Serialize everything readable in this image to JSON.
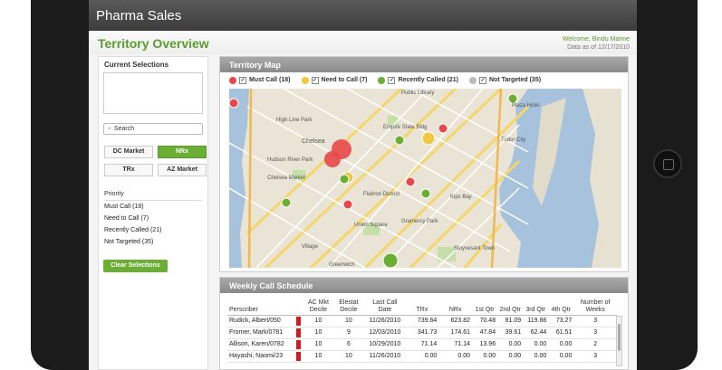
{
  "app": {
    "title": "Pharma Sales"
  },
  "header": {
    "page_title": "Territory Overview",
    "welcome": "Welcome, Bindu Manne",
    "as_of": "Data as of 12/17/2010"
  },
  "left": {
    "current_selections_title": "Current Selections",
    "search_placeholder": "Search",
    "markets": [
      "DC Market",
      "NRx",
      "TRx",
      "AZ Market"
    ],
    "active_market": "NRx",
    "priority_title": "Priority",
    "priority_items": [
      "Must Call (18)",
      "Need to Call (7)",
      "Recently Called (21)",
      "Not Targeted (35)"
    ],
    "clear_button": "Clear Selections"
  },
  "map_panel": {
    "title": "Territory Map",
    "legend": [
      {
        "label": "Must Call (18)",
        "color": "#e8484a",
        "checked": true
      },
      {
        "label": "Need to Call (7)",
        "color": "#f0c840",
        "checked": true
      },
      {
        "label": "Recently Called (21)",
        "color": "#6aae34",
        "checked": true
      },
      {
        "label": "Not Targeted (35)",
        "color": "#bcbcbc",
        "checked": true
      }
    ],
    "map_labels": [
      "High Line Park",
      "Chelsea",
      "Hudson River Park",
      "Chelsea Market",
      "Flatiron District",
      "Union Square",
      "Gramercy Park",
      "Kips Bay",
      "Stuyvesant Town",
      "Greenwich",
      "Public Library",
      "Plaza Hotel",
      "Tudor City",
      "Empire State Bldg",
      "Village"
    ]
  },
  "schedule": {
    "title": "Weekly Call Schedule",
    "columns": [
      "Perscriber",
      "",
      "AC Mkt Decile",
      "Elestat Decile",
      "Last Call Date",
      "TRx",
      "NRx",
      "1st Qtr",
      "2nd Qtr",
      "3rd Qtr",
      "4th Qtr",
      "Number of Weeks"
    ],
    "rows": [
      [
        "Rudick, Albert/050",
        "10",
        "10",
        "11/26/2010",
        "739.64",
        "623.82",
        "70.48",
        "81.09",
        "119.88",
        "73.27",
        "3"
      ],
      [
        "Fromer, Mark/0781",
        "10",
        "9",
        "12/03/2010",
        "341.73",
        "174.61",
        "47.84",
        "39.61",
        "62.44",
        "61.51",
        "3"
      ],
      [
        "Allison, Karen/0782",
        "10",
        "6",
        "10/29/2010",
        "71.14",
        "71.14",
        "13.96",
        "0.00",
        "0.00",
        "0.00",
        "2"
      ],
      [
        "Hayashi, Naomi/23",
        "10",
        "10",
        "11/26/2010",
        "0.00",
        "0.00",
        "0.00",
        "0.00",
        "0.00",
        "0.00",
        "3"
      ]
    ]
  },
  "colors": {
    "accent": "#5c9c2c",
    "must_call": "#e8484a"
  }
}
